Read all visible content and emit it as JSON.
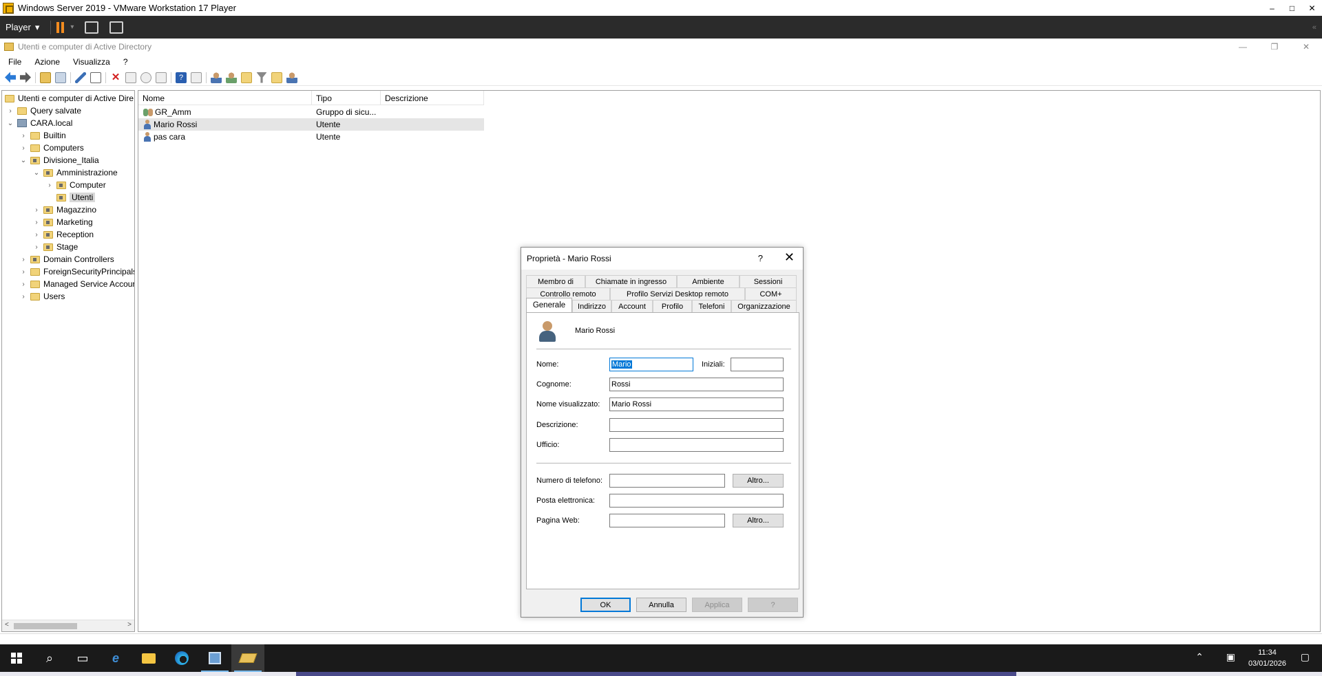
{
  "vmware": {
    "title": "Windows Server 2019 - VMware Workstation 17 Player",
    "player_label": "Player",
    "minimize": "–",
    "maximize": "□",
    "close": "✕",
    "right_icon": "«"
  },
  "mmc": {
    "title": "Utenti e computer di Active Directory",
    "menu": [
      "File",
      "Azione",
      "Visualizza",
      "?"
    ],
    "min": "—",
    "restore": "❐",
    "close": "✕"
  },
  "tree": {
    "root": "Utenti e computer di Active Dire",
    "items": [
      {
        "label": "Query salvate",
        "chev": "›"
      },
      {
        "label": "CARA.local",
        "chev": "⌄"
      },
      {
        "label": "Builtin",
        "chev": "›"
      },
      {
        "label": "Computers",
        "chev": "›"
      },
      {
        "label": "Divisione_Italia",
        "chev": "⌄"
      },
      {
        "label": "Amministrazione",
        "chev": "⌄"
      },
      {
        "label": "Computer",
        "chev": "›"
      },
      {
        "label": "Utenti",
        "chev": ""
      },
      {
        "label": "Magazzino",
        "chev": "›"
      },
      {
        "label": "Marketing",
        "chev": "›"
      },
      {
        "label": "Reception",
        "chev": "›"
      },
      {
        "label": "Stage",
        "chev": "›"
      },
      {
        "label": "Domain Controllers",
        "chev": "›"
      },
      {
        "label": "ForeignSecurityPrincipals",
        "chev": "›"
      },
      {
        "label": "Managed Service Accour",
        "chev": "›"
      },
      {
        "label": "Users",
        "chev": "›"
      }
    ],
    "scroll_left": "<",
    "scroll_right": ">"
  },
  "list": {
    "columns": [
      "Nome",
      "Tipo",
      "Descrizione"
    ],
    "rows": [
      {
        "name": "GR_Amm",
        "type": "Gruppo di sicu...",
        "icon": "group-icon"
      },
      {
        "name": "Mario Rossi",
        "type": "Utente",
        "icon": "user-icon"
      },
      {
        "name": "pas cara",
        "type": "Utente",
        "icon": "user-icon"
      }
    ]
  },
  "dialog": {
    "title": "Proprietà - Mario Rossi",
    "help": "?",
    "close": "✕",
    "tabs_row1": [
      "Membro di",
      "Chiamate in ingresso",
      "Ambiente",
      "Sessioni"
    ],
    "tabs_row2": [
      "Controllo remoto",
      "Profilo Servizi Desktop remoto",
      "COM+"
    ],
    "tabs_row3": [
      "Generale",
      "Indirizzo",
      "Account",
      "Profilo",
      "Telefoni",
      "Organizzazione"
    ],
    "display_name_header": "Mario Rossi",
    "fields": {
      "nome_label": "Nome:",
      "nome_value": "Mario",
      "iniziali_label": "Iniziali:",
      "iniziali_value": "",
      "cognome_label": "Cognome:",
      "cognome_value": "Rossi",
      "nome_visualizzato_label": "Nome visualizzato:",
      "nome_visualizzato_value": "Mario Rossi",
      "descrizione_label": "Descrizione:",
      "descrizione_value": "",
      "ufficio_label": "Ufficio:",
      "ufficio_value": "",
      "telefono_label": "Numero di telefono:",
      "telefono_value": "",
      "posta_label": "Posta elettronica:",
      "posta_value": "",
      "web_label": "Pagina Web:",
      "web_value": "",
      "altro_label": "Altro..."
    },
    "buttons": {
      "ok": "OK",
      "annulla": "Annulla",
      "applica": "Applica",
      "help": "?"
    }
  },
  "taskbar": {
    "time": "11:34",
    "date": "03/01/2026"
  }
}
